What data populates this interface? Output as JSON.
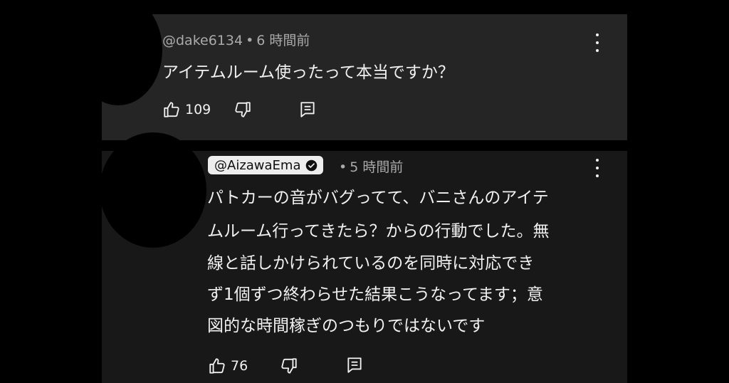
{
  "comment": {
    "author": "@dake6134",
    "separator": "•",
    "time": "6 時間前",
    "text": "アイテムルーム使ったって本当ですか？",
    "likes": "109"
  },
  "reply": {
    "author": "@AizawaEma",
    "separator": "•",
    "time": "5 時間前",
    "lines": [
      "パトカーの音がバグってて、バニさんのアイテ",
      "ムルーム行ってきたら？からの行動でした。無",
      "線と話しかけられているのを同時に対応でき",
      "ず1個ずつ終わらせた結果こうなってます；意",
      "図的な時間稼ぎのつもりではないです"
    ],
    "likes": "76"
  },
  "icons": {
    "like": "thumbs-up-icon",
    "dislike": "thumbs-down-icon",
    "reply": "comment-icon",
    "more": "more-vert-icon",
    "verified": "verified-check-icon"
  },
  "colors": {
    "background": "#000000",
    "card_top": "#252525",
    "card_bottom": "#181818",
    "text": "#f1f1f1",
    "meta": "#aaaaaa",
    "badge": "#ededed"
  }
}
